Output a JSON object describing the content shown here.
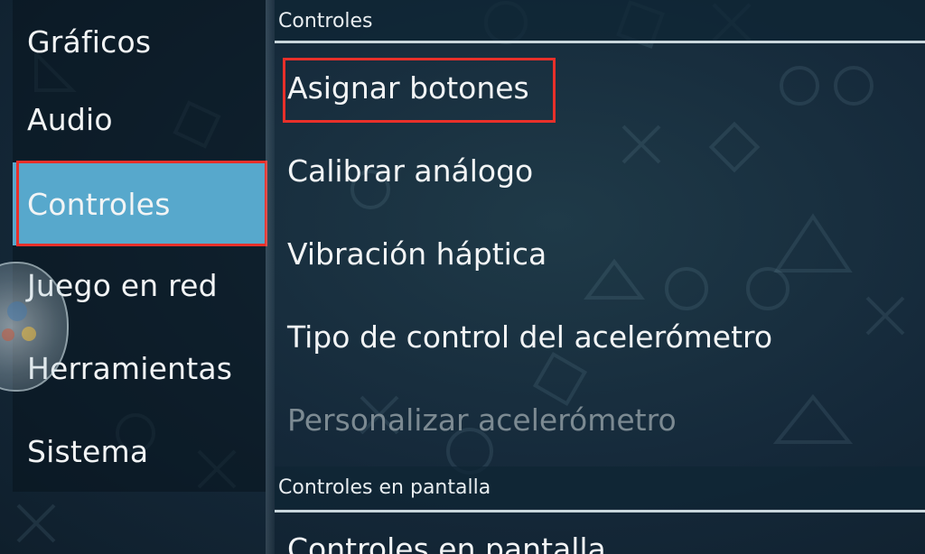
{
  "sidebar": {
    "items": [
      {
        "label": "Gráficos",
        "active": false
      },
      {
        "label": "Audio",
        "active": false
      },
      {
        "label": "Controles",
        "active": true
      },
      {
        "label": "Juego en red",
        "active": false
      },
      {
        "label": "Herramientas",
        "active": false
      },
      {
        "label": "Sistema",
        "active": false
      }
    ]
  },
  "main": {
    "sections": [
      {
        "header": "Controles",
        "items": [
          {
            "label": "Asignar botones",
            "enabled": true
          },
          {
            "label": "Calibrar análogo",
            "enabled": true
          },
          {
            "label": "Vibración háptica",
            "enabled": true
          },
          {
            "label": "Tipo de control del acelerómetro",
            "enabled": true
          },
          {
            "label": "Personalizar acelerómetro",
            "enabled": false
          }
        ]
      },
      {
        "header": "Controles en pantalla",
        "items": [
          {
            "label": "Controles en pantalla",
            "enabled": true
          }
        ]
      }
    ]
  },
  "colors": {
    "active_item": "#57a8cc",
    "highlight_box": "#e8302a",
    "disabled_text": "#7c8a92"
  }
}
